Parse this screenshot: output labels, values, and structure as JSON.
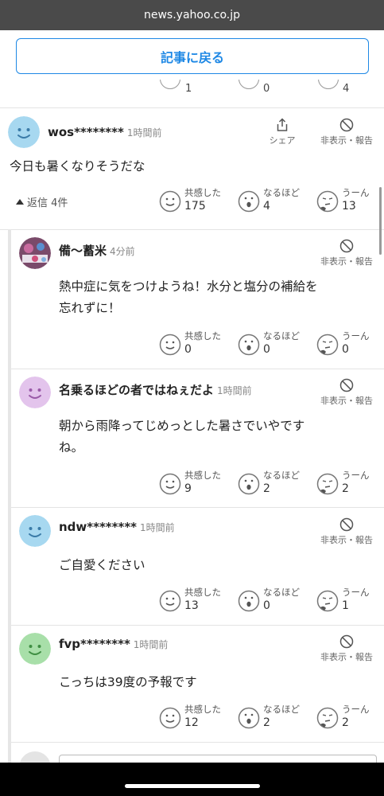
{
  "browser": {
    "url": "news.yahoo.co.jp"
  },
  "header": {
    "back_label": "記事に戻る"
  },
  "prev_comment": {
    "sympathy": "1",
    "insight": "0",
    "hmm": "4"
  },
  "main_comment": {
    "user": "wos********",
    "time": "1時間前",
    "share_label": "シェア",
    "hide_label": "非表示・報告",
    "text": "今日も暑くなりそうだな",
    "replies_label": "返信 4件",
    "reactions": {
      "sympathy": "175",
      "insight": "4",
      "hmm": "13"
    }
  },
  "reaction_labels": {
    "sympathy": "共感した",
    "insight": "なるほど",
    "hmm": "うーん"
  },
  "replies": [
    {
      "user": "備〜蓄米",
      "time": "4分前",
      "hide_label": "非表示・報告",
      "text_lines": [
        "熱中症に気をつけようね！水分と塩分の補給を",
        "忘れずに！"
      ],
      "reactions": {
        "sympathy": "0",
        "insight": "0",
        "hmm": "0"
      }
    },
    {
      "user": "名乗るほどの者ではねぇだよ",
      "time": "1時間前",
      "hide_label": "非表示・報告",
      "text_lines": [
        "朝から雨降ってじめっとした暑さでいやです",
        "ね。"
      ],
      "reactions": {
        "sympathy": "9",
        "insight": "2",
        "hmm": "2"
      }
    },
    {
      "user": "ndw********",
      "time": "1時間前",
      "hide_label": "非表示・報告",
      "text_lines": [
        "ご自愛ください"
      ],
      "reactions": {
        "sympathy": "13",
        "insight": "0",
        "hmm": "1"
      }
    },
    {
      "user": "fvp********",
      "time": "1時間前",
      "hide_label": "非表示・報告",
      "text_lines": [
        "こっちは39度の予報です"
      ],
      "reactions": {
        "sympathy": "12",
        "insight": "2",
        "hmm": "2"
      }
    }
  ],
  "colors": {
    "accent": "#1e88e5",
    "avatar_blue": "#a7d8f0",
    "avatar_purple": "#e3c4ec",
    "avatar_green": "#a8dfa9"
  }
}
